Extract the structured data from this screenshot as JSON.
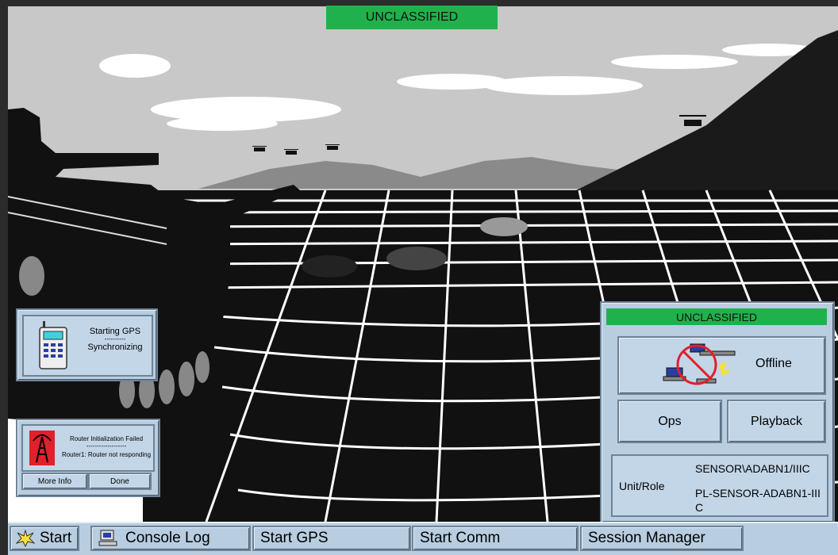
{
  "top_banner": "UNCLASSIFIED",
  "gps_panel": {
    "icon": "gps-radio-icon",
    "line1": "Starting GPS",
    "dashes": "----------",
    "line2": "Synchronizing"
  },
  "router_panel": {
    "icon": "router-tower-alert-icon",
    "title": "Router Initialization Failed",
    "dashes": "-------------------",
    "message": "Router1: Router not responding",
    "more_info": "More Info",
    "done": "Done"
  },
  "session_panel": {
    "banner": "UNCLASSIFIED",
    "status_icon": "network-offline-icon",
    "status": "Offline",
    "ops": "Ops",
    "playback": "Playback",
    "unit_role_label": "Unit/Role",
    "unit": "SENSOR\\ADABN1/IIIC",
    "role": "PL-SENSOR-ADABN1-III C"
  },
  "taskbar": {
    "start": "Start",
    "start_icon": "star-burst-icon",
    "console_log": "Console Log",
    "console_icon": "computer-icon",
    "start_gps": "Start GPS",
    "start_comm": "Start Comm",
    "session_manager": "Session Manager"
  },
  "colors": {
    "banner_green": "#20b14c",
    "panel_blue": "#b8cde0"
  }
}
